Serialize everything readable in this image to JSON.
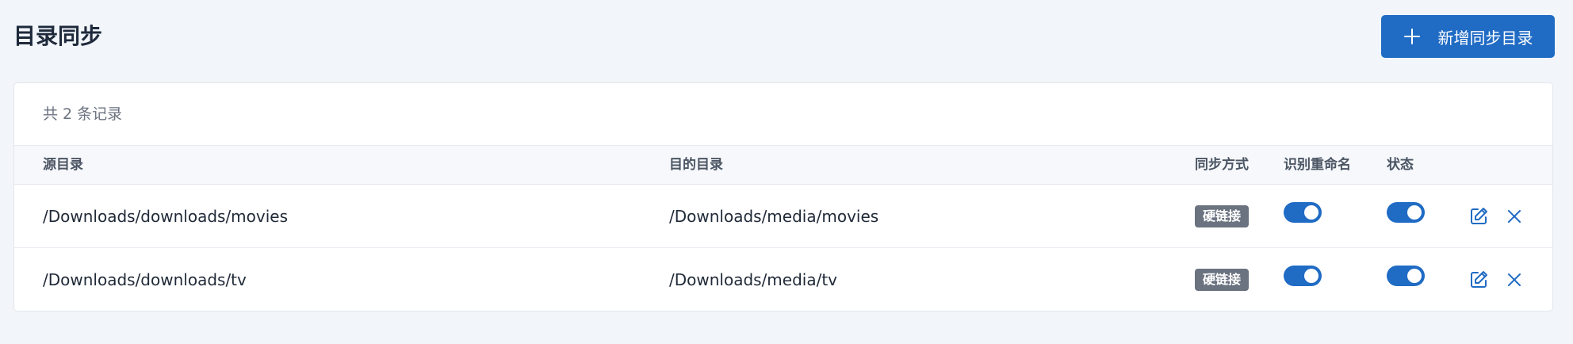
{
  "page": {
    "title": "目录同步",
    "add_button_label": "新增同步目录"
  },
  "table": {
    "record_count": "共 2 条记录",
    "columns": {
      "source": "源目录",
      "target": "目的目录",
      "sync_mode": "同步方式",
      "rename": "识别重命名",
      "status": "状态"
    },
    "rows": [
      {
        "source": "/Downloads/downloads/movies",
        "target": "/Downloads/media/movies",
        "sync_mode": "硬链接",
        "rename_enabled": true,
        "status_enabled": true
      },
      {
        "source": "/Downloads/downloads/tv",
        "target": "/Downloads/media/tv",
        "sync_mode": "硬链接",
        "rename_enabled": true,
        "status_enabled": true
      }
    ]
  },
  "colors": {
    "accent": "#206bc4",
    "badge": "#6b7280",
    "background": "#f2f5f9"
  },
  "icons": {
    "add": "plus-icon",
    "edit": "edit-icon",
    "delete": "close-icon"
  }
}
